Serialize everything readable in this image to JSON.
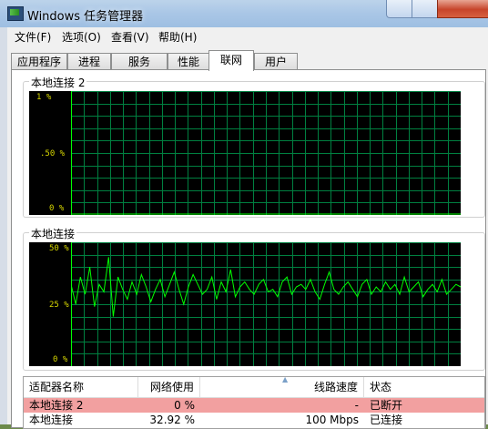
{
  "window": {
    "title": "Windows 任务管理器"
  },
  "menu": [
    {
      "label": "文件(F)"
    },
    {
      "label": "选项(O)"
    },
    {
      "label": "查看(V)"
    },
    {
      "label": "帮助(H)"
    }
  ],
  "tabs": [
    {
      "label": "应用程序"
    },
    {
      "label": "进程"
    },
    {
      "label": "服务"
    },
    {
      "label": "性能"
    },
    {
      "label": "联网"
    },
    {
      "label": "用户"
    }
  ],
  "active_tab": "联网",
  "graphs": [
    {
      "label": "本地连接 2",
      "y_labels": [
        "1 %",
        ".50 %",
        "0 %"
      ],
      "max": 1,
      "values": [
        0,
        0,
        0,
        0,
        0,
        0,
        0,
        0,
        0,
        0,
        0,
        0,
        0,
        0,
        0,
        0,
        0,
        0,
        0,
        0
      ]
    },
    {
      "label": "本地连接",
      "y_labels": [
        "50 %",
        "25 %",
        "0 %"
      ],
      "max": 50,
      "values": [
        33,
        25,
        36,
        29,
        40,
        24,
        33,
        30,
        44,
        20,
        36,
        31,
        27,
        34,
        29,
        37,
        32,
        26,
        31,
        35,
        28,
        33,
        38,
        31,
        25,
        32,
        37,
        33,
        29,
        31,
        36,
        27,
        34,
        30,
        39,
        28,
        32,
        34,
        31,
        29,
        33,
        35,
        30,
        31,
        28,
        34,
        36,
        29,
        32,
        33,
        31,
        35,
        30,
        27,
        33,
        38,
        31,
        29,
        32,
        34,
        31,
        28,
        33,
        35,
        29,
        32,
        30,
        34,
        31,
        33,
        29,
        36,
        30,
        32,
        34,
        28,
        31,
        33,
        30,
        35,
        29,
        31,
        33,
        32
      ]
    }
  ],
  "adapter_table": {
    "columns": [
      "适配器名称",
      "网络使用率",
      "线路速度",
      "状态"
    ],
    "rows": [
      {
        "name": "本地连接 2",
        "usage": "0 %",
        "speed": "-",
        "status": "已断开"
      },
      {
        "name": "本地连接",
        "usage": "32.92 %",
        "speed": "100 Mbps",
        "status": "已连接"
      }
    ]
  },
  "colors": {
    "graph_bg": "#000000",
    "grid": "#008040",
    "line": "#00ff00",
    "label_yellow": "#d6d600",
    "highlight_row": "#f2a0a0"
  }
}
